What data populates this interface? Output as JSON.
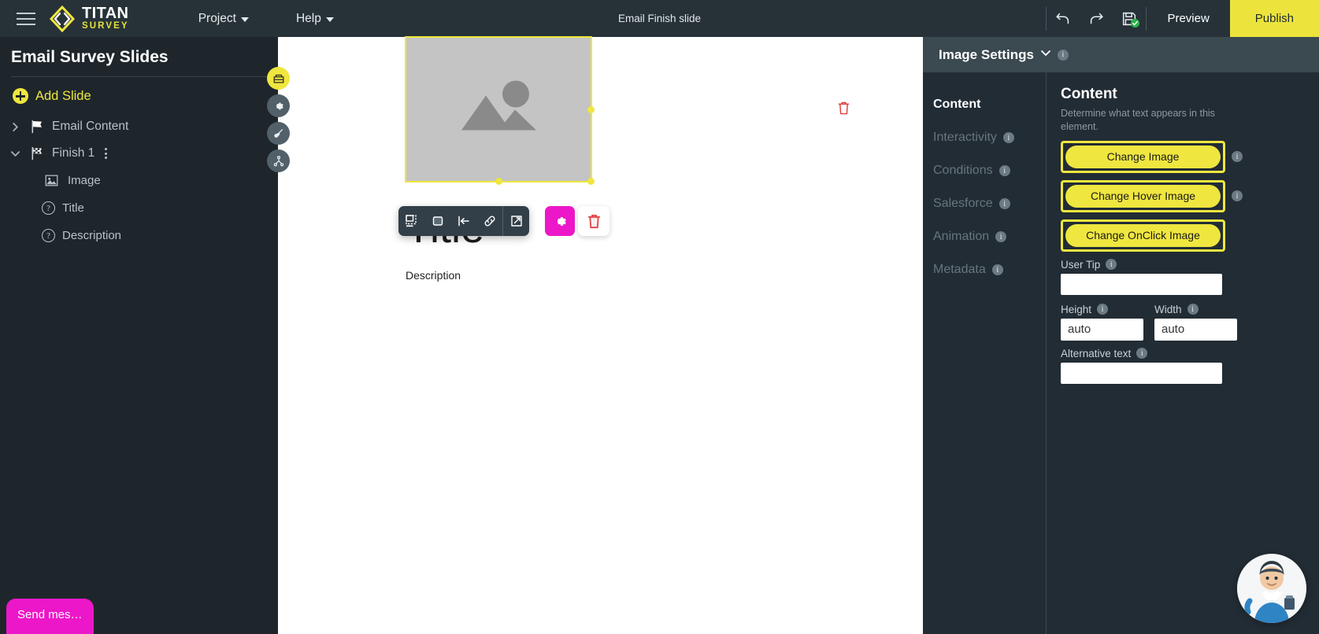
{
  "topbar": {
    "menu_icon": "hamburger-icon",
    "logo": {
      "title": "TITAN",
      "subtitle": "SURVEY",
      "mark": "titan-diamond-logo"
    },
    "menus": [
      {
        "label": "Project",
        "name": "menu-project"
      },
      {
        "label": "Help",
        "name": "menu-help"
      }
    ],
    "document_title": "Email Finish slide",
    "actions": [
      {
        "name": "undo-icon",
        "label": "Undo"
      },
      {
        "name": "redo-icon",
        "label": "Redo"
      },
      {
        "name": "save-icon",
        "label": "Save"
      }
    ],
    "preview_label": "Preview",
    "publish_label": "Publish",
    "publish_color": "#ece43d"
  },
  "sidebar": {
    "title": "Email Survey Slides",
    "add_slide_label": "Add Slide",
    "tree": [
      {
        "label": "Email Content",
        "icon": "flag-white-icon",
        "expanded": false,
        "children": []
      },
      {
        "label": "Finish 1",
        "icon": "flag-checkered-icon",
        "expanded": true,
        "kebab": "more-options-icon",
        "children": [
          {
            "label": "Image",
            "icon": "image-icon"
          },
          {
            "label": "Title",
            "icon": "question-icon"
          },
          {
            "label": "Description",
            "icon": "question-icon"
          }
        ]
      }
    ],
    "send_message_label": "Send mes…",
    "send_message_color": "#ec17c8"
  },
  "side_actions": [
    {
      "name": "layers-icon",
      "color": "#efe63f"
    },
    {
      "name": "gear-icon",
      "color": "#526069"
    },
    {
      "name": "brush-icon",
      "color": "#526069"
    },
    {
      "name": "flow-icon",
      "color": "#526069"
    }
  ],
  "canvas": {
    "image_placeholder": "image-placeholder",
    "selection_color": "#efe63f",
    "title_text": "Title",
    "description_text": "Description",
    "delete_icon": "trash-red-icon",
    "element_toolbar": [
      {
        "name": "border-icon",
        "label": "Border"
      },
      {
        "name": "background-icon",
        "label": "Background"
      },
      {
        "name": "align-left-icon",
        "label": "Align"
      },
      {
        "name": "link-icon",
        "label": "Link"
      },
      {
        "name": "open-external-icon",
        "label": "Open"
      }
    ],
    "toolbar_gear": {
      "name": "gear-icon",
      "color": "#ec17c8"
    },
    "toolbar_delete": {
      "name": "trash-icon",
      "color": "#e03b3b"
    }
  },
  "right_panel": {
    "title": "Image Settings",
    "chevron": "chevron-down-icon",
    "tabs": [
      {
        "label": "Content",
        "active": true,
        "info": false
      },
      {
        "label": "Interactivity",
        "active": false,
        "info": true
      },
      {
        "label": "Conditions",
        "active": false,
        "info": true
      },
      {
        "label": "Salesforce",
        "active": false,
        "info": true
      },
      {
        "label": "Animation",
        "active": false,
        "info": true
      },
      {
        "label": "Metadata",
        "active": false,
        "info": true
      }
    ],
    "content": {
      "heading": "Content",
      "subtitle": "Determine what text appears in this element.",
      "buttons": [
        {
          "label": "Change Image",
          "highlighted": true
        },
        {
          "label": "Change Hover Image",
          "highlighted": true
        },
        {
          "label": "Change OnClick Image",
          "highlighted": true
        }
      ],
      "fields": [
        {
          "label": "User Tip",
          "value": "",
          "placeholder": ""
        },
        {
          "label": "Height",
          "value": "auto"
        },
        {
          "label": "Width",
          "value": "auto"
        },
        {
          "label": "Alternative text",
          "value": "",
          "placeholder": ""
        }
      ]
    }
  },
  "mascot": {
    "name": "support-mascot-avatar"
  }
}
